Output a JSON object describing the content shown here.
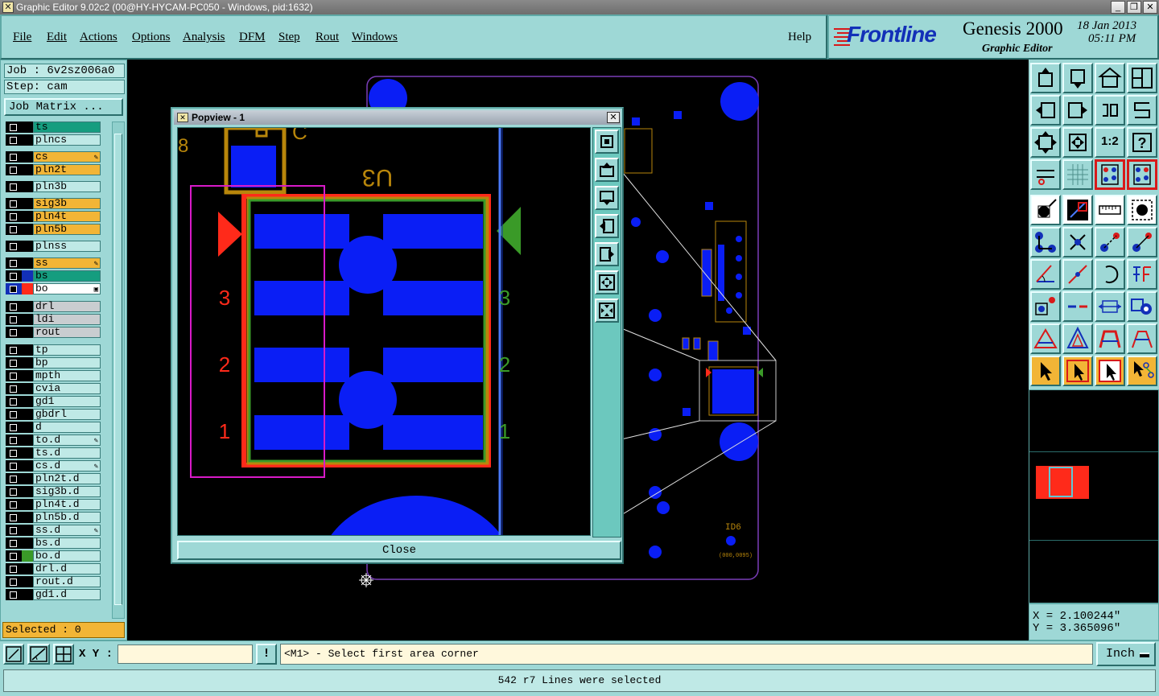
{
  "window": {
    "title": "Graphic Editor 9.02c2 (00@HY-HYCAM-PC050 - Windows, pid:1632)",
    "min_glyph": "_",
    "max_glyph": "❐",
    "close_glyph": "✕"
  },
  "menu": {
    "items": [
      "File",
      "Edit",
      "Actions",
      "Options",
      "Analysis",
      "DFM",
      "Step",
      "Rout",
      "Windows"
    ],
    "help": "Help"
  },
  "brand": {
    "logo": "Frontline",
    "product": "Genesis 2000",
    "subtitle": "Graphic Editor",
    "date": "18 Jan 2013",
    "time": "05:11 PM"
  },
  "job": {
    "job_label": "Job : 6v2sz006a0",
    "step_label": "Step: cam",
    "matrix_button": "Job Matrix ...",
    "selected": "Selected : 0"
  },
  "layers": [
    {
      "name": "ts",
      "color": "#159d7f",
      "mark": ""
    },
    {
      "name": "plncs",
      "color": "#bfe9e6",
      "mark": ""
    },
    {
      "name": "cs",
      "color": "#f2b536",
      "mark": "✎"
    },
    {
      "name": "pln2t",
      "color": "#f2b536",
      "mark": ""
    },
    {
      "name": "pln3b",
      "color": "#bfe9e6",
      "mark": ""
    },
    {
      "name": "sig3b",
      "color": "#f2b536",
      "mark": ""
    },
    {
      "name": "pln4t",
      "color": "#f2b536",
      "mark": ""
    },
    {
      "name": "pln5b",
      "color": "#f2b536",
      "mark": ""
    },
    {
      "name": "plnss",
      "color": "#bfe9e6",
      "mark": ""
    },
    {
      "name": "ss",
      "color": "#f2b536",
      "mark": "✎"
    },
    {
      "name": "bs",
      "color": "#159d7f",
      "mark": ""
    },
    {
      "name": "bo",
      "color": "#ffffff",
      "mark": "▣"
    },
    {
      "name": "drl",
      "color": "#c9cdd0",
      "mark": ""
    },
    {
      "name": "ldi",
      "color": "#c9cdd0",
      "mark": ""
    },
    {
      "name": "rout",
      "color": "#c9cdd0",
      "mark": ""
    },
    {
      "name": "tp",
      "color": "#bfe9e6",
      "mark": ""
    },
    {
      "name": "bp",
      "color": "#bfe9e6",
      "mark": ""
    },
    {
      "name": "mpth",
      "color": "#bfe9e6",
      "mark": ""
    },
    {
      "name": "cvia",
      "color": "#bfe9e6",
      "mark": ""
    },
    {
      "name": "gd1",
      "color": "#bfe9e6",
      "mark": ""
    },
    {
      "name": "gbdrl",
      "color": "#bfe9e6",
      "mark": ""
    },
    {
      "name": "d",
      "color": "#bfe9e6",
      "mark": ""
    },
    {
      "name": "to.d",
      "color": "#bfe9e6",
      "mark": "✎"
    },
    {
      "name": "ts.d",
      "color": "#bfe9e6",
      "mark": ""
    },
    {
      "name": "cs.d",
      "color": "#bfe9e6",
      "mark": "✎"
    },
    {
      "name": "pln2t.d",
      "color": "#bfe9e6",
      "mark": ""
    },
    {
      "name": "sig3b.d",
      "color": "#bfe9e6",
      "mark": ""
    },
    {
      "name": "pln4t.d",
      "color": "#bfe9e6",
      "mark": ""
    },
    {
      "name": "pln5b.d",
      "color": "#bfe9e6",
      "mark": ""
    },
    {
      "name": "ss.d",
      "color": "#bfe9e6",
      "mark": "✎"
    },
    {
      "name": "bs.d",
      "color": "#bfe9e6",
      "mark": ""
    },
    {
      "name": "bo.d",
      "color": "#bfe9e6",
      "mark": ""
    },
    {
      "name": "drl.d",
      "color": "#bfe9e6",
      "mark": ""
    },
    {
      "name": "rout.d",
      "color": "#bfe9e6",
      "mark": ""
    },
    {
      "name": "gd1.d",
      "color": "#bfe9e6",
      "mark": ""
    }
  ],
  "popview": {
    "title": "Popview - 1",
    "close_glyph": "✕",
    "close_button": "Close",
    "ref_top": "U3",
    "pin_labels": [
      "3",
      "2",
      "1"
    ]
  },
  "board": {
    "ref_id": "ID6",
    "coord_note": "(000,0095)"
  },
  "coords": {
    "x": "X = 2.100244\"",
    "y": "Y = 3.365096\""
  },
  "command": {
    "xy_label": "X Y :",
    "xy_value": "",
    "excl": "!",
    "prompt": "<M1> - Select first area corner",
    "units": "Inch"
  },
  "status": "542 r7 Lines were selected",
  "colors": {
    "panel": "#9ed8d6",
    "pad": "#0a1ef5",
    "outline": "#b8860b",
    "highlight": "#ff2a1a",
    "accent_green": "#3a9a28"
  }
}
